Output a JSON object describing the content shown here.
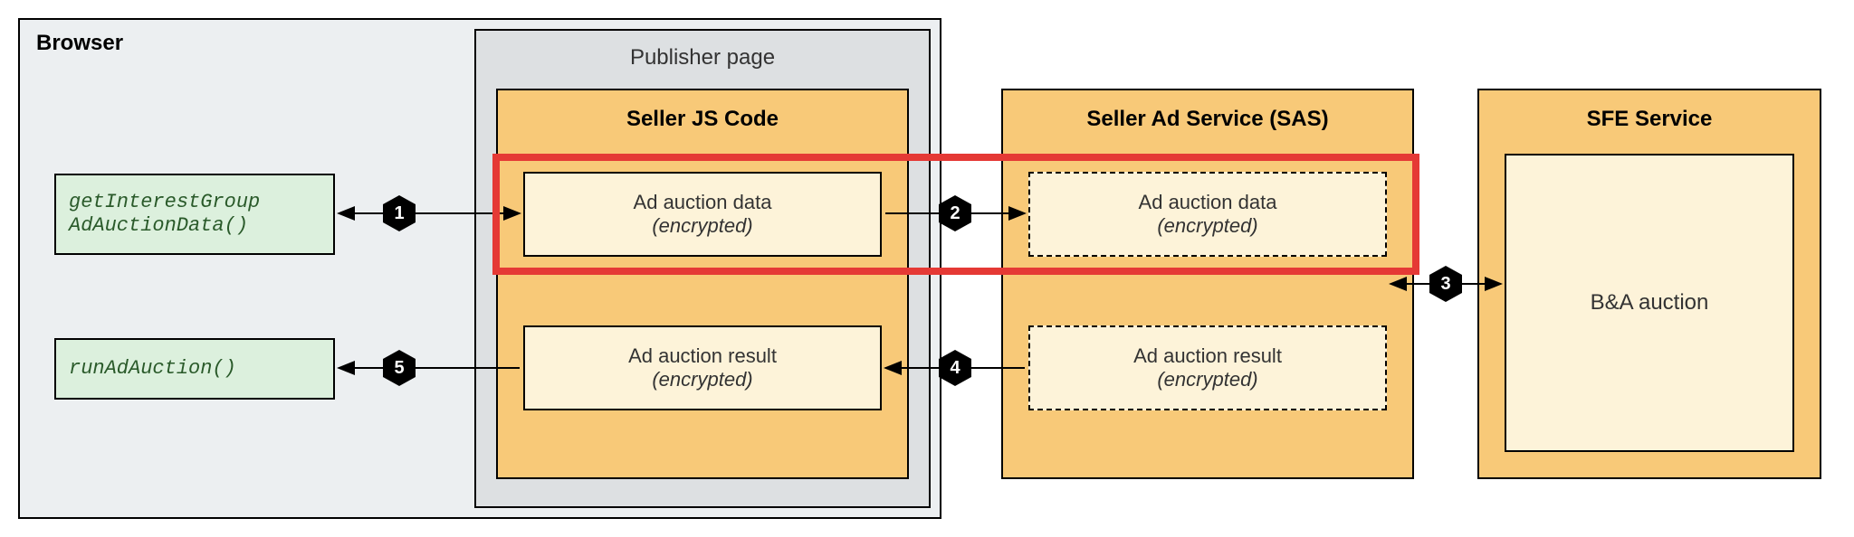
{
  "browser": {
    "label": "Browser"
  },
  "publisher": {
    "label": "Publisher page"
  },
  "seller_js": {
    "title": "Seller JS Code",
    "data_box": {
      "title": "Ad auction data",
      "sub": "(encrypted)"
    },
    "result_box": {
      "title": "Ad auction result",
      "sub": "(encrypted)"
    }
  },
  "sas": {
    "title": "Seller Ad Service (SAS)",
    "data_box": {
      "title": "Ad auction data",
      "sub": "(encrypted)"
    },
    "result_box": {
      "title": "Ad auction result",
      "sub": "(encrypted)"
    }
  },
  "sfe": {
    "title": "SFE Service",
    "auction_box": "B&A auction"
  },
  "api": {
    "get_interest_group_line1": "getInterestGroup",
    "get_interest_group_line2": "AdAuctionData()",
    "run_ad_auction": "runAdAuction()"
  },
  "steps": {
    "s1": "1",
    "s2": "2",
    "s3": "3",
    "s4": "4",
    "s5": "5"
  }
}
